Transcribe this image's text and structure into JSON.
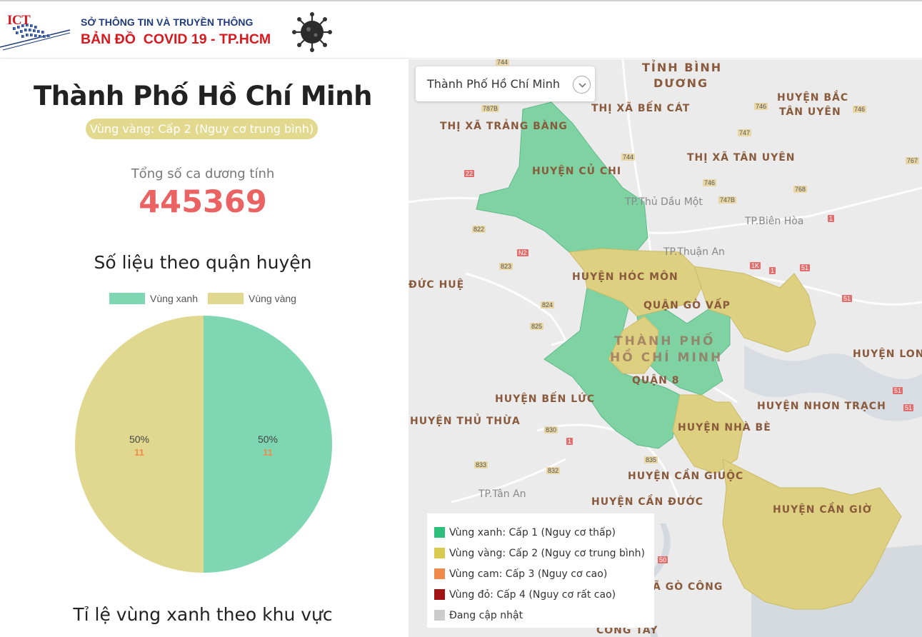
{
  "header": {
    "logo_text": "ICT",
    "subtitle": "SỞ THÔNG TIN VÀ TRUYỀN THÔNG",
    "title": "BẢN ĐỒ  COVID 19 - TP.HCM",
    "brand_red": "#d71920",
    "brand_blue": "#1f3b7a"
  },
  "summary": {
    "city": "Thành Phố Hồ Chí Minh",
    "zone_badge": "Vùng vàng: Cấp 2 (Nguy cơ trung bình)",
    "total_label": "Tổng số ca dương tính",
    "total_value": "445369",
    "district_section_title": "Số liệu theo quận huyện",
    "green_ratio_title": "Tỉ lệ vùng xanh theo khu vực"
  },
  "chart_data": {
    "type": "pie",
    "legend": [
      "Vùng xanh",
      "Vùng vàng"
    ],
    "colors": [
      "#7fd6b3",
      "#e0d88f"
    ],
    "values": [
      11,
      11
    ],
    "percent_labels": [
      "50%",
      "50%"
    ]
  },
  "map": {
    "dropdown": {
      "selected": "Thành Phố Hồ Chí Minh",
      "icon": "chevron-down-icon"
    },
    "labels": [
      "TỈNH BÌNH",
      "DƯƠNG",
      "HUYỆN BẮC",
      "TÂN UYÊN",
      "THỊ XÃ BẾN CÁT",
      "THỊ XÃ TRẢNG BÀNG",
      "THỊ XÃ TÂN UYÊN",
      "HUYỆN CỦ CHI",
      "HUYỆN HÓC MÔN",
      "QUẬN GÒ VẤP",
      "THÀNH PHỐ",
      "HỒ CHÍ MINH",
      "QUẬN 8",
      "HUYỆN BẾN LỨC",
      "HUYỆN THỦ THỪA",
      "HUYỆN NHÀ BÈ",
      "HUYỆN CẦN GIUỘC",
      "HUYỆN CẦN ĐƯỚC",
      "HUYỆN CẦN GIỜ",
      "HUYỆN NHƠN TRẠCH",
      "HUYỆN LONG",
      "ĐỨC HUỆ",
      "Ã GÒ CÔNG",
      "CÔNG TÂY"
    ],
    "cities": [
      "TP.Thủ Dầu Một",
      "TP.Biên Hòa",
      "TP.Thuận An",
      "TP.Tân An"
    ],
    "legend": [
      {
        "label": "Vùng xanh: Cấp 1 (Nguy cơ thấp)",
        "color": "#2ebf7d"
      },
      {
        "label": "Vùng vàng: Cấp 2 (Nguy cơ trung bình)",
        "color": "#d9c94e"
      },
      {
        "label": "Vùng cam: Cấp 3 (Nguy cơ cao)",
        "color": "#f08a4b"
      },
      {
        "label": "Vùng đỏ: Cấp 4 (Nguy cơ rất cao)",
        "color": "#a11212"
      },
      {
        "label": "Đang cập nhật",
        "color": "#cccccc"
      }
    ]
  }
}
